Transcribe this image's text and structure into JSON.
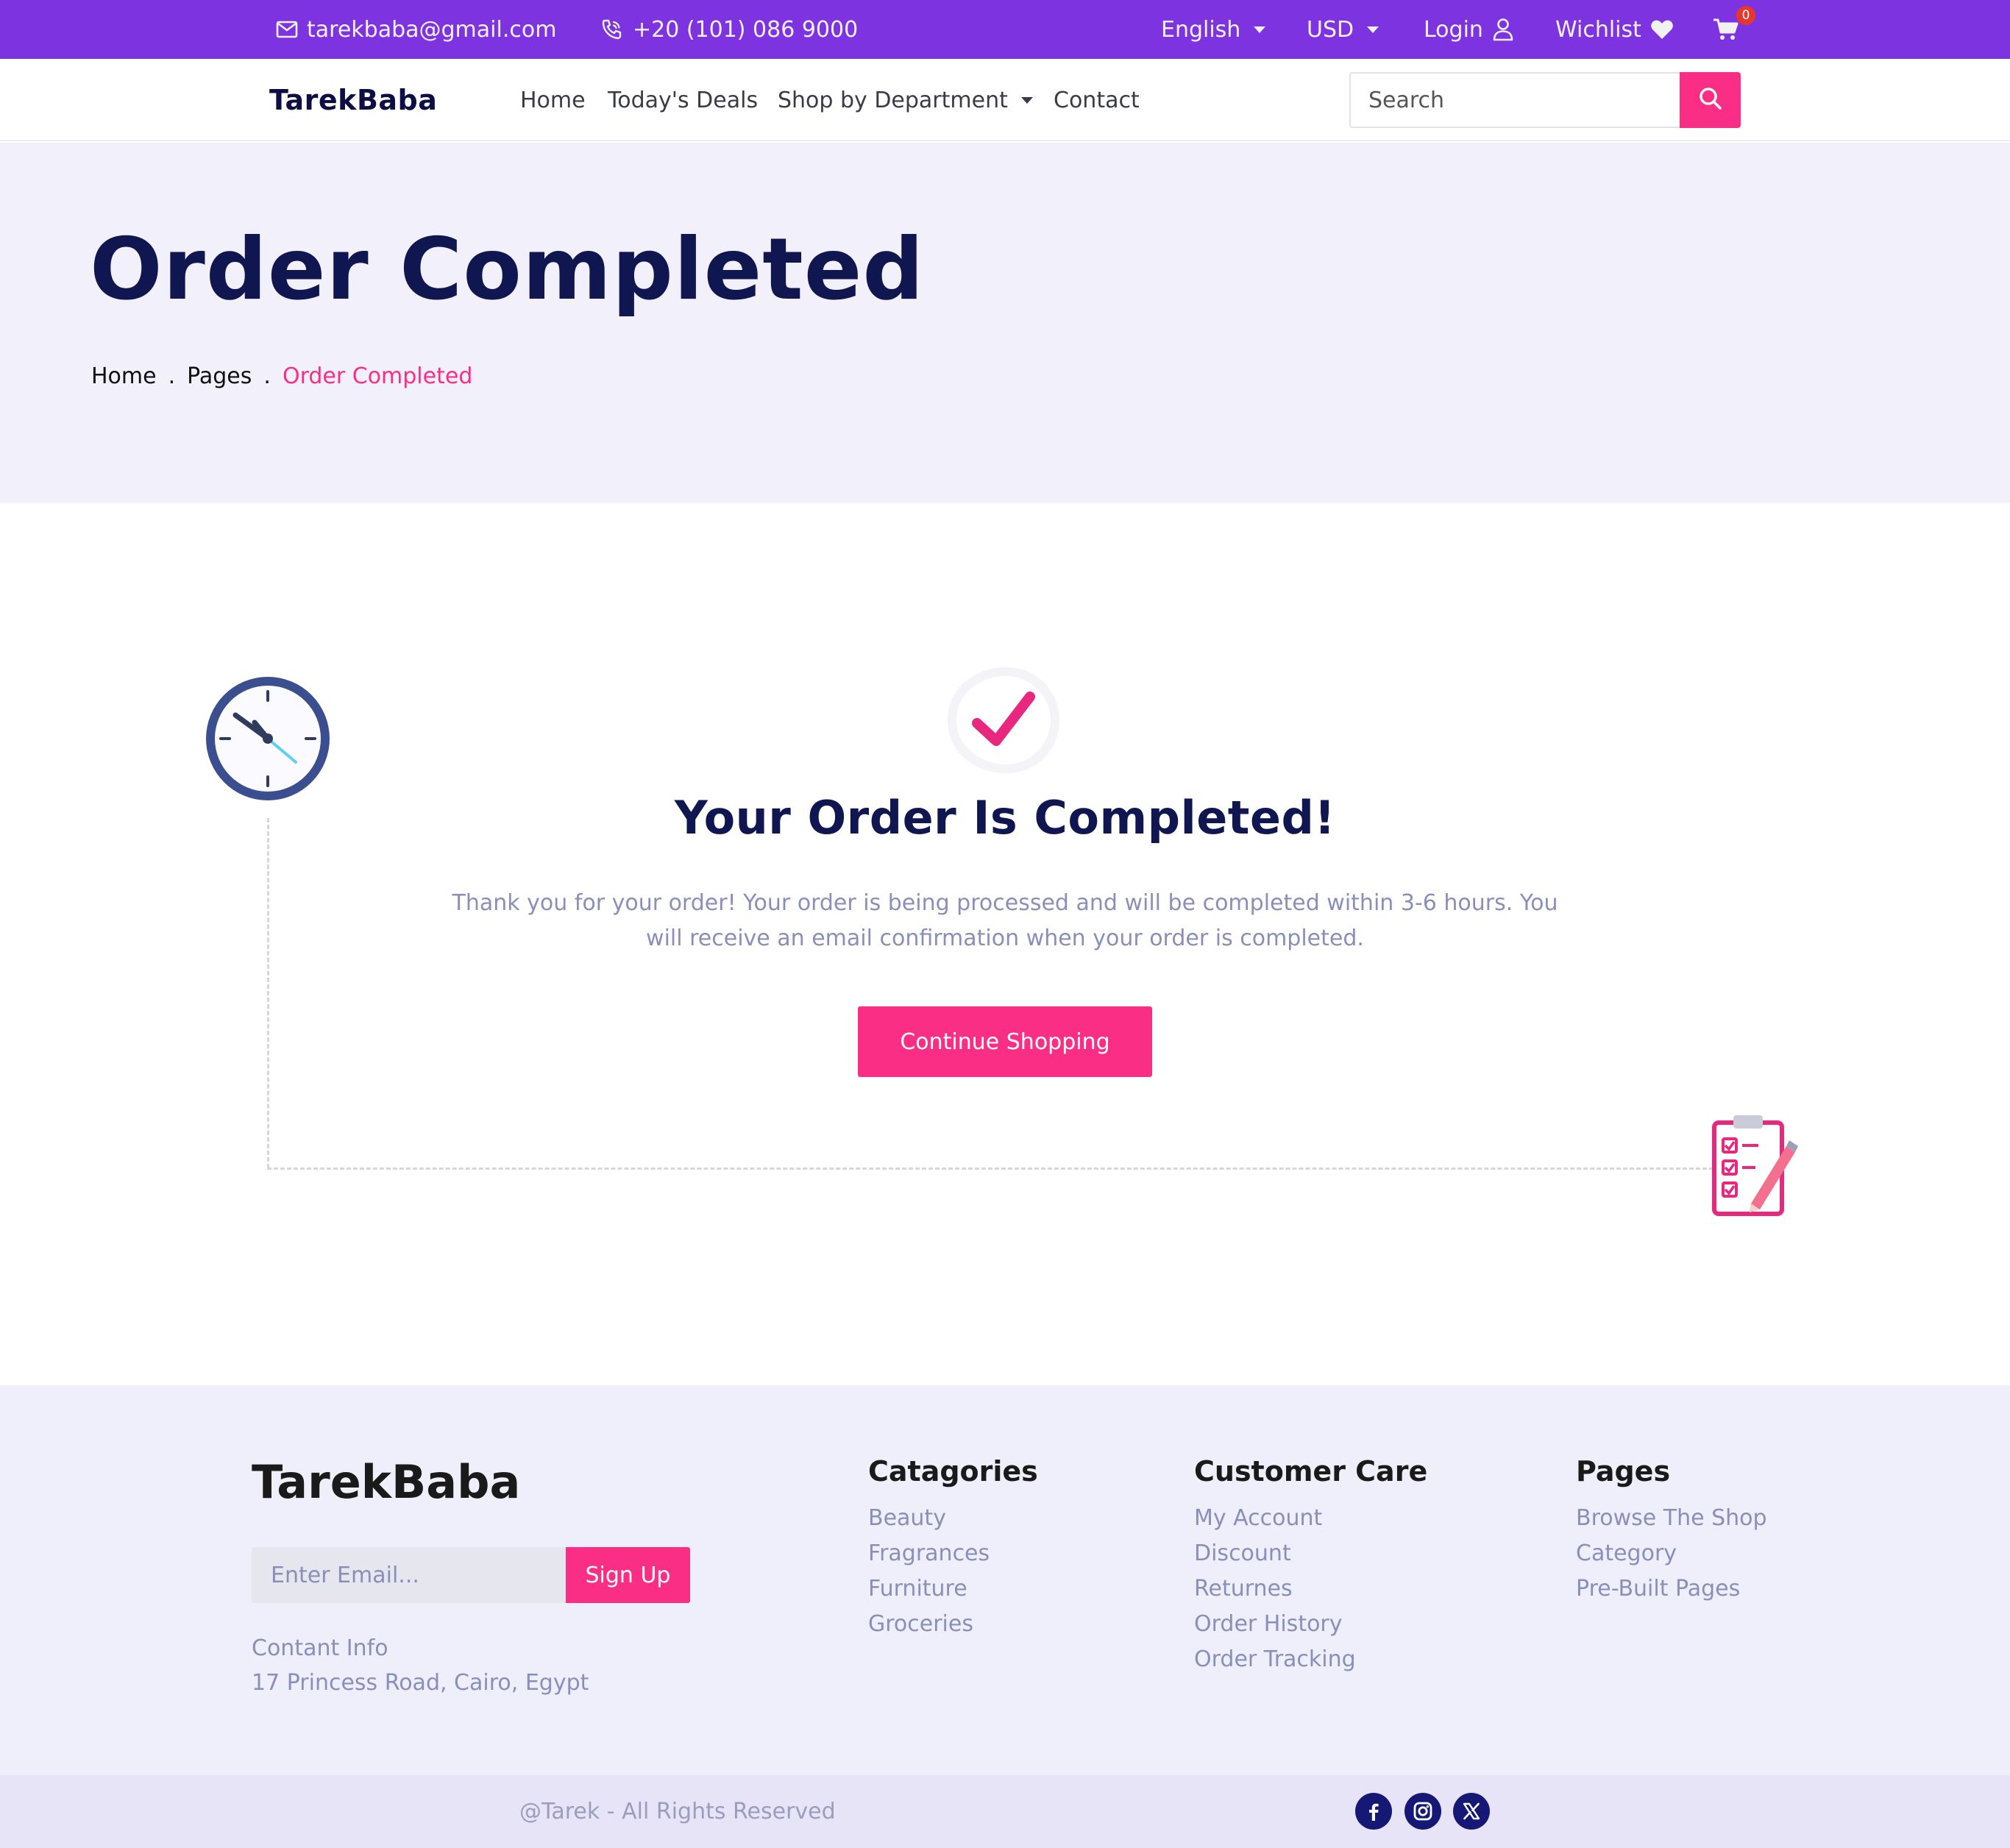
{
  "topbar": {
    "email": "tarekbaba@gmail.com",
    "phone": "+20 (101) 086 9000",
    "language": "English",
    "currency": "USD",
    "login": "Login",
    "wishlist": "Wichlist",
    "cart_count": "0",
    "icons": [
      "mail-icon",
      "phone-icon",
      "user-icon",
      "heart-icon",
      "cart-icon"
    ],
    "background_color": "#7e33e0"
  },
  "navbar": {
    "brand": "TarekBaba",
    "links": {
      "home": "Home",
      "deals": "Today's Deals",
      "shop": "Shop by Department",
      "contact": "Contact"
    },
    "search_placeholder": "Search",
    "accent_color": "#fb2e86"
  },
  "hero": {
    "title": "Order Completed",
    "breadcrumb": {
      "home": "Home",
      "sep": ".",
      "pages": "Pages",
      "current": "Order Completed"
    }
  },
  "main": {
    "title": "Your Order Is Completed!",
    "message": "Thank you for your order! Your order is being processed and will be completed within 3-6 hours. You will receive an email confirmation when your order is completed.",
    "continue_label": "Continue Shopping",
    "icons": [
      "clock-icon",
      "checkmark-icon",
      "clipboard-checklist-icon"
    ]
  },
  "footer": {
    "brand": "TarekBaba",
    "email_placeholder": "Enter Email...",
    "signup_label": "Sign Up",
    "contact_label": "Contant Info",
    "address": "17 Princess Road, Cairo, Egypt",
    "columns": [
      {
        "title": "Catagories",
        "links": [
          "Beauty",
          "Fragrances",
          "Furniture",
          "Groceries"
        ]
      },
      {
        "title": "Customer Care",
        "links": [
          "My Account",
          "Discount",
          "Returnes",
          "Order History",
          "Order Tracking"
        ]
      },
      {
        "title": "Pages",
        "links": [
          "Browse The Shop",
          "Category",
          "Pre-Built Pages"
        ]
      }
    ],
    "copyright": "@Tarek - All Rights Reserved",
    "social_icons": [
      "facebook-icon",
      "instagram-icon",
      "x-icon"
    ]
  }
}
